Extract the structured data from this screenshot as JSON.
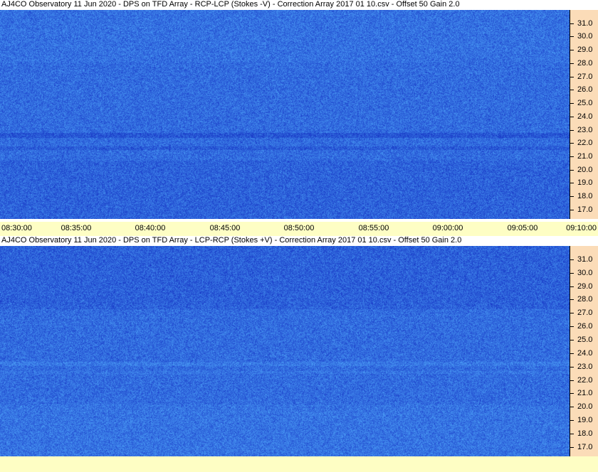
{
  "panels": [
    {
      "title": "AJ4CO Observatory 11 Jun 2020  -  DPS on TFD Array  -  RCP-LCP (Stokes -V)  -  Correction Array 2017 01 10.csv  -  Offset 50  Gain 2.0"
    },
    {
      "title": "AJ4CO Observatory 11 Jun 2020  -  DPS on TFD Array  -  LCP-RCP (Stokes +V)  -  Correction Array 2017 01 10.csv  -  Offset 50  Gain 2.0"
    }
  ],
  "colors": {
    "spectrogram_base": "#2b64e6",
    "spectrogram_dark": "#1a3cc8",
    "spectrogram_light": "#4a9cf5",
    "yaxis_bg": "#fbdcb8",
    "xaxis_bg": "#fefec4"
  },
  "chart_data": [
    {
      "type": "heatmap",
      "title": "AJ4CO Observatory 11 Jun 2020  -  DPS on TFD Array  -  RCP-LCP (Stokes -V)  -  Correction Array 2017 01 10.csv  -  Offset 50  Gain 2.0",
      "x_tick_labels": [
        "08:30:00",
        "08:35:00",
        "08:40:00",
        "08:45:00",
        "08:50:00",
        "08:55:00",
        "09:00:00",
        "09:05:00",
        "09:10:00"
      ],
      "y_tick_labels": [
        "31.0",
        "30.0",
        "29.0",
        "28.0",
        "27.0",
        "26.0",
        "25.0",
        "24.0",
        "23.0",
        "22.0",
        "21.0",
        "20.0",
        "19.0",
        "18.0",
        "17.0"
      ],
      "y_values": [
        31,
        30,
        29,
        28,
        27,
        26,
        25,
        24,
        23,
        22,
        21,
        20,
        19,
        18,
        17
      ],
      "ylim": [
        16.3,
        32.0
      ],
      "xlim": [
        "08:30:00",
        "09:10:00"
      ]
    },
    {
      "type": "heatmap",
      "title": "AJ4CO Observatory 11 Jun 2020  -  DPS on TFD Array  -  LCP-RCP (Stokes +V)  -  Correction Array 2017 01 10.csv  -  Offset 50  Gain 2.0",
      "y_tick_labels": [
        "31.0",
        "30.0",
        "29.0",
        "28.0",
        "27.0",
        "26.0",
        "25.0",
        "24.0",
        "23.0",
        "22.0",
        "21.0",
        "20.0",
        "19.0",
        "18.0",
        "17.0"
      ],
      "y_values": [
        31,
        30,
        29,
        28,
        27,
        26,
        25,
        24,
        23,
        22,
        21,
        20,
        19,
        18,
        17
      ],
      "ylim": [
        16.3,
        32.0
      ]
    }
  ]
}
